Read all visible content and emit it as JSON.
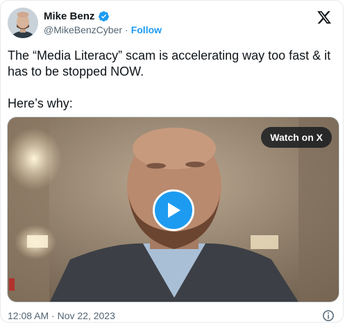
{
  "author": {
    "name": "Mike Benz",
    "handle": "@MikeBenzCyber",
    "separator": "·",
    "follow_label": "Follow",
    "verified": true
  },
  "tweet": {
    "paragraphs": [
      "The “Media Literacy” scam is accelerating way too fast & it has to be stopped NOW.",
      "Here’s why:"
    ]
  },
  "media": {
    "watch_label": "Watch on X",
    "type": "video"
  },
  "footer": {
    "timestamp": "12:08 AM · Nov 22, 2023"
  },
  "icons": {
    "logo": "x-logo-icon",
    "verified": "verified-badge-icon",
    "play": "play-icon",
    "info": "info-icon"
  },
  "colors": {
    "accent": "#1d9bf0",
    "text_primary": "#0f1419",
    "text_secondary": "#536471"
  }
}
